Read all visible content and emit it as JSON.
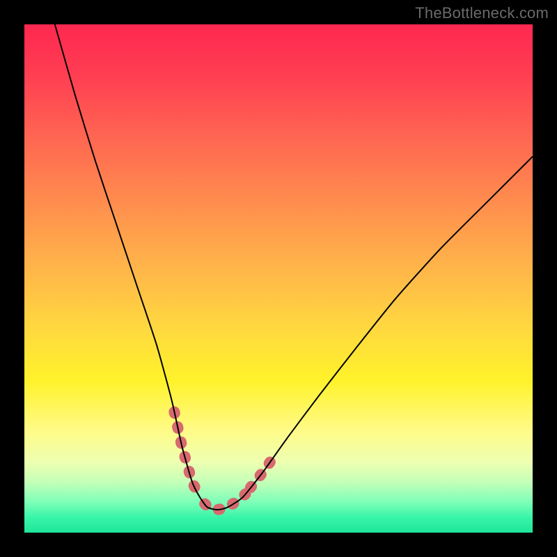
{
  "watermark": "TheBottleneck.com",
  "chart_data": {
    "type": "line",
    "title": "",
    "xlabel": "",
    "ylabel": "",
    "xlim": [
      0,
      100
    ],
    "ylim": [
      0,
      100
    ],
    "series": [
      {
        "name": "bottleneck-curve",
        "x": [
          6,
          10,
          14,
          18,
          22,
          26,
          29,
          31,
          33,
          34.5,
          36,
          38,
          40,
          43,
          47,
          52,
          58,
          65,
          73,
          82,
          92,
          100
        ],
        "values": [
          100,
          86,
          73,
          61,
          49,
          37,
          26,
          17,
          10,
          7,
          5,
          4.5,
          5,
          7,
          12,
          19,
          27,
          36,
          46,
          56,
          66,
          74
        ]
      }
    ],
    "highlight_segments": [
      {
        "x_range": [
          29.5,
          34.5
        ],
        "side": "left"
      },
      {
        "x_range": [
          35.5,
          43.5
        ],
        "side": "bottom"
      },
      {
        "x_range": [
          44.5,
          49.0
        ],
        "side": "right"
      }
    ],
    "colors": {
      "curve": "#000000",
      "highlight": "#d76a6e",
      "gradient_top": "#ff2850",
      "gradient_bottom": "#1fe599",
      "frame": "#000000"
    }
  }
}
